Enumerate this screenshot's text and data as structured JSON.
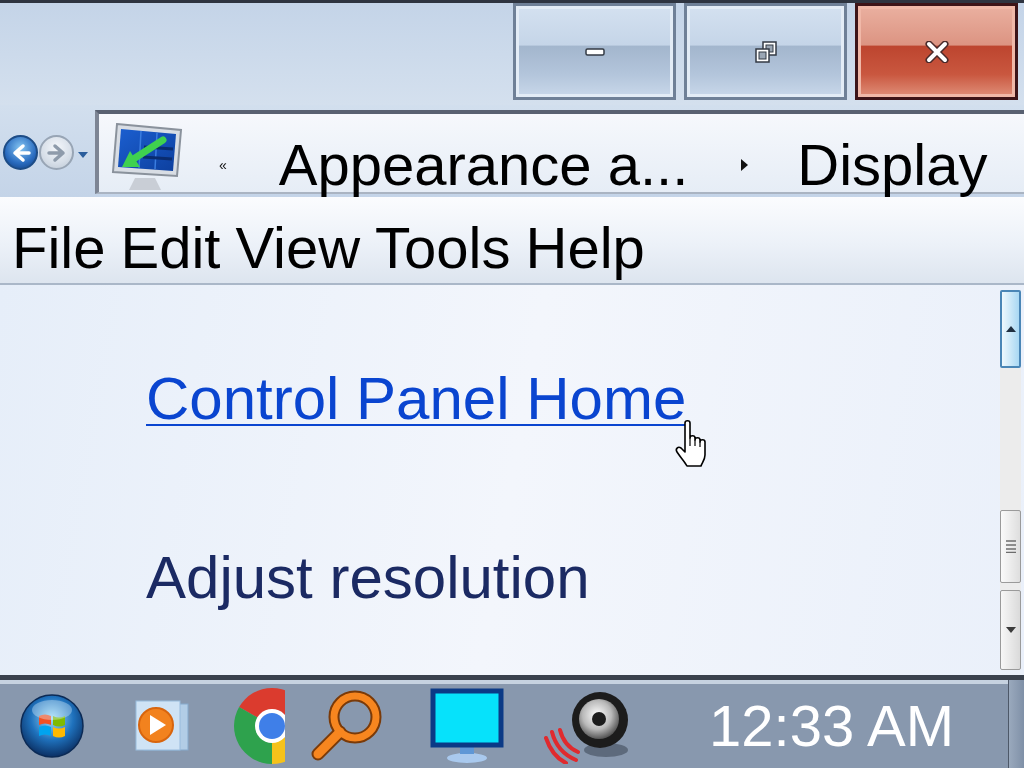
{
  "navigation": {
    "back": {
      "disabled": false
    },
    "forward": {
      "disabled": true
    }
  },
  "address_bar": {
    "overflow_mark": "«",
    "breadcrumbs": [
      "Appearance a...",
      "Display"
    ]
  },
  "menu_bar": {
    "items": [
      "File",
      "Edit",
      "View",
      "Tools",
      "Help"
    ]
  },
  "sidebar": {
    "links": [
      {
        "label": "Control Panel Home",
        "hovered": true
      },
      {
        "label": "Adjust resolution",
        "hovered": false
      }
    ]
  },
  "taskbar": {
    "clock": "12:33 AM"
  }
}
